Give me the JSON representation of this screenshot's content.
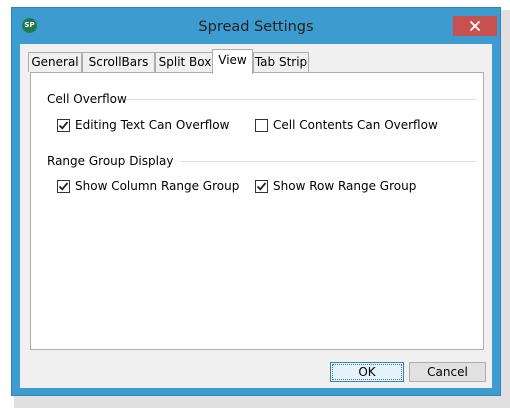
{
  "window": {
    "title": "Spread Settings",
    "app_icon_text": "SP",
    "accent": "#3d9bd0",
    "close_color": "#c75050"
  },
  "tabs": [
    {
      "label": "General",
      "active": false
    },
    {
      "label": "ScrollBars",
      "active": false
    },
    {
      "label": "Split Box",
      "active": false
    },
    {
      "label": "View",
      "active": true
    },
    {
      "label": "Tab Strip",
      "active": false
    }
  ],
  "groups": {
    "cell_overflow": {
      "label": "Cell Overflow",
      "options": [
        {
          "label": "Editing Text Can Overflow",
          "checked": true
        },
        {
          "label": "Cell Contents Can Overflow",
          "checked": false
        }
      ]
    },
    "range_group_display": {
      "label": "Range Group Display",
      "options": [
        {
          "label": "Show Column Range Group",
          "checked": true
        },
        {
          "label": "Show Row Range Group",
          "checked": true
        }
      ]
    }
  },
  "buttons": {
    "ok": "OK",
    "cancel": "Cancel"
  }
}
